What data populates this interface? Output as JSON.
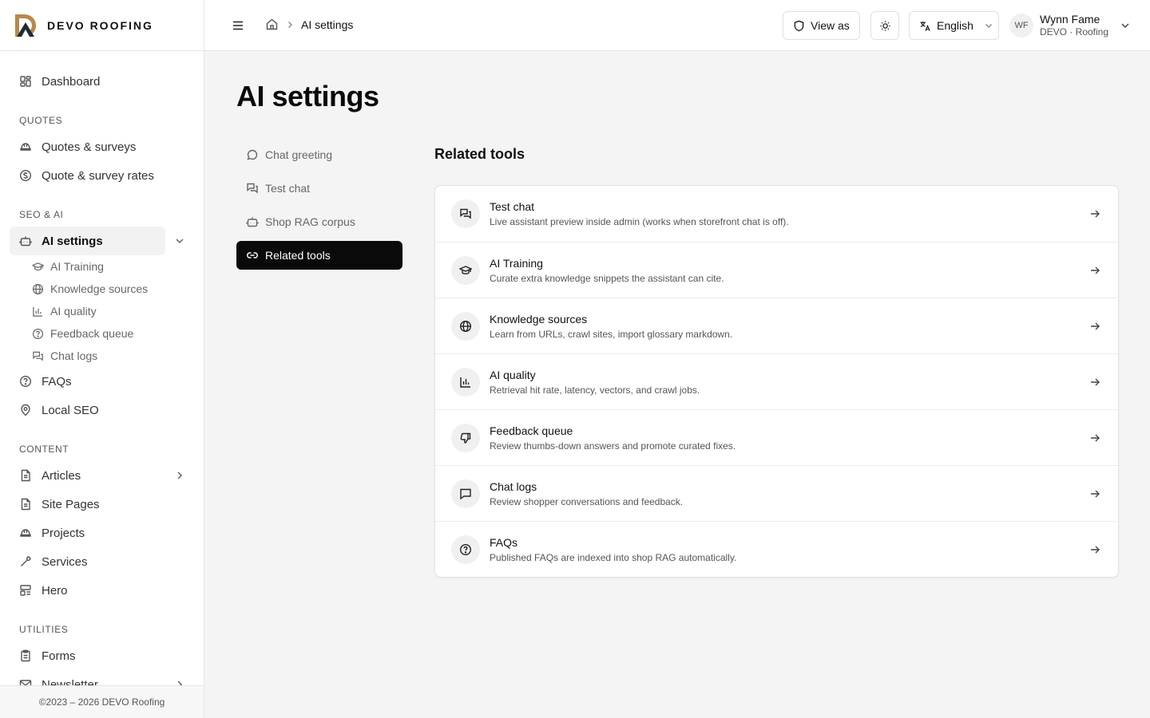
{
  "brand": {
    "name": "DEVO ROOFING"
  },
  "sidebar": {
    "dashboard": "Dashboard",
    "sections": {
      "quotes": "QUOTES",
      "seo_ai": "SEO & AI",
      "content": "CONTENT",
      "utilities": "UTILITIES"
    },
    "quotes_items": [
      "Quotes & surveys",
      "Quote & survey rates"
    ],
    "ai_settings": "AI settings",
    "ai_sub": [
      "AI Training",
      "Knowledge sources",
      "AI quality",
      "Feedback queue",
      "Chat logs"
    ],
    "seo_items": [
      "FAQs",
      "Local SEO"
    ],
    "content_items": [
      "Articles",
      "Site Pages",
      "Projects",
      "Services",
      "Hero"
    ],
    "utilities_items": [
      "Forms",
      "Newsletter"
    ],
    "footer": "©2023 – 2026 DEVO Roofing"
  },
  "header": {
    "breadcrumb_current": "AI settings",
    "view_as": "View as",
    "language": "English",
    "user": {
      "initials": "WF",
      "name": "Wynn Fame",
      "org": "DEVO · Roofing"
    }
  },
  "main": {
    "title": "AI settings",
    "subnav": [
      "Chat greeting",
      "Test chat",
      "Shop RAG corpus",
      "Related tools"
    ],
    "section_title": "Related tools",
    "tools": [
      {
        "title": "Test chat",
        "desc": "Live assistant preview inside admin (works when storefront chat is off).",
        "icon": "chat-bubbles-icon"
      },
      {
        "title": "AI Training",
        "desc": "Curate extra knowledge snippets the assistant can cite.",
        "icon": "graduation-cap-icon"
      },
      {
        "title": "Knowledge sources",
        "desc": "Learn from URLs, crawl sites, import glossary markdown.",
        "icon": "globe-icon"
      },
      {
        "title": "AI quality",
        "desc": "Retrieval hit rate, latency, vectors, and crawl jobs.",
        "icon": "bar-chart-icon"
      },
      {
        "title": "Feedback queue",
        "desc": "Review thumbs-down answers and promote curated fixes.",
        "icon": "thumbs-down-icon"
      },
      {
        "title": "Chat logs",
        "desc": "Review shopper conversations and feedback.",
        "icon": "message-icon"
      },
      {
        "title": "FAQs",
        "desc": "Published FAQs are indexed into shop RAG automatically.",
        "icon": "help-circle-icon"
      }
    ]
  },
  "colors": {
    "active_nav": "#0a0a0a",
    "page_bg": "#f4f4f4",
    "logo_gold": "#b8894a"
  }
}
